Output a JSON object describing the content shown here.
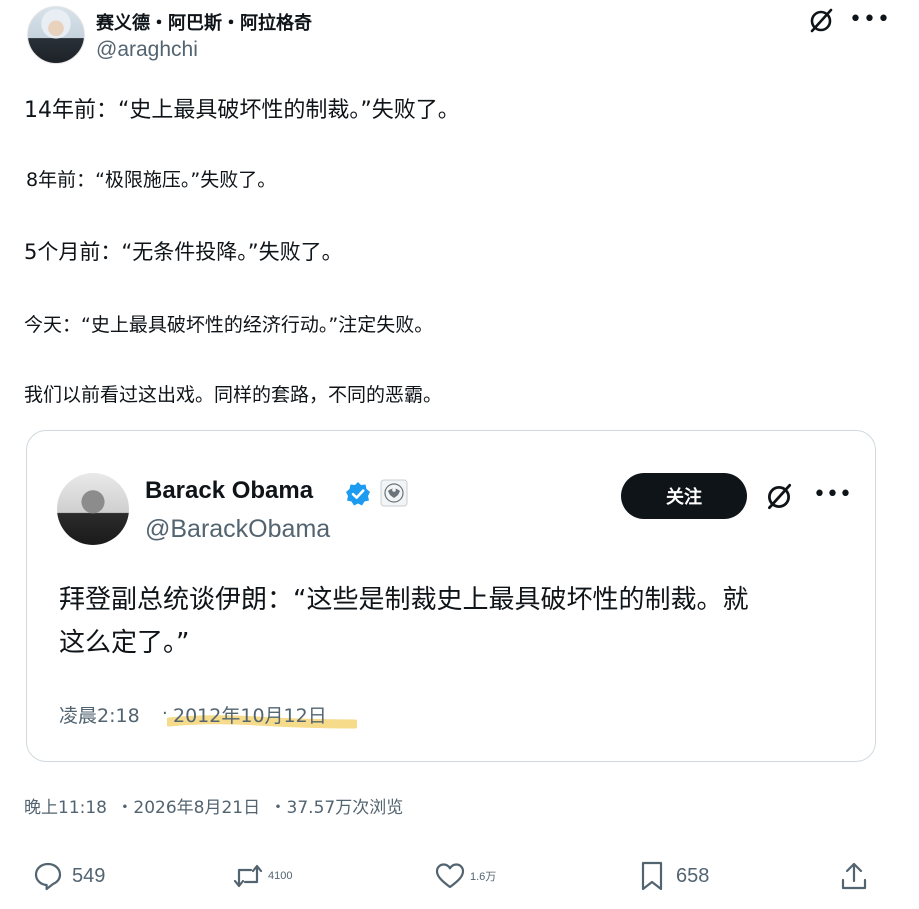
{
  "post": {
    "author_name": "赛义德・阿巴斯・阿拉格奇",
    "author_handle": "@araghchi",
    "lines": [
      "14年前：“史上最具破坏性的制裁。”失败了。",
      "8年前：“极限施压。”失败了。",
      "5个月前：“无条件投降。”失败了。",
      "今天：“史上最具破坏性的经济行动。”注定失败。",
      "我们以前看过这出戏。同样的套路，不同的恶霸。"
    ],
    "meta": {
      "time": "晚上11:18",
      "date": "・2026年8月21日",
      "views": "・37.57万次浏览"
    }
  },
  "quoted": {
    "name": "Barack Obama",
    "handle": "@BarackObama",
    "follow_label": "关注",
    "text": "拜登副总统谈伊朗：“这些是制裁史上最具破坏性的制裁。就这么定了。”",
    "time": "凌晨2:18",
    "date": "2012年10月12日"
  },
  "actions": {
    "replies": "549",
    "reposts": "4100",
    "likes": "1.6万",
    "bookmarks": "658"
  },
  "icons": {
    "grok": "grok-icon",
    "more": "more-icon",
    "verified": "verified-badge-icon",
    "seal": "government-seal-icon",
    "reply": "reply-icon",
    "repost": "repost-icon",
    "like": "heart-icon",
    "bookmark": "bookmark-icon",
    "share": "share-icon"
  },
  "colors": {
    "text": "#0f1419",
    "muted": "#536471",
    "verified": "#1d9bf0",
    "highlight": "#f2cf63"
  }
}
